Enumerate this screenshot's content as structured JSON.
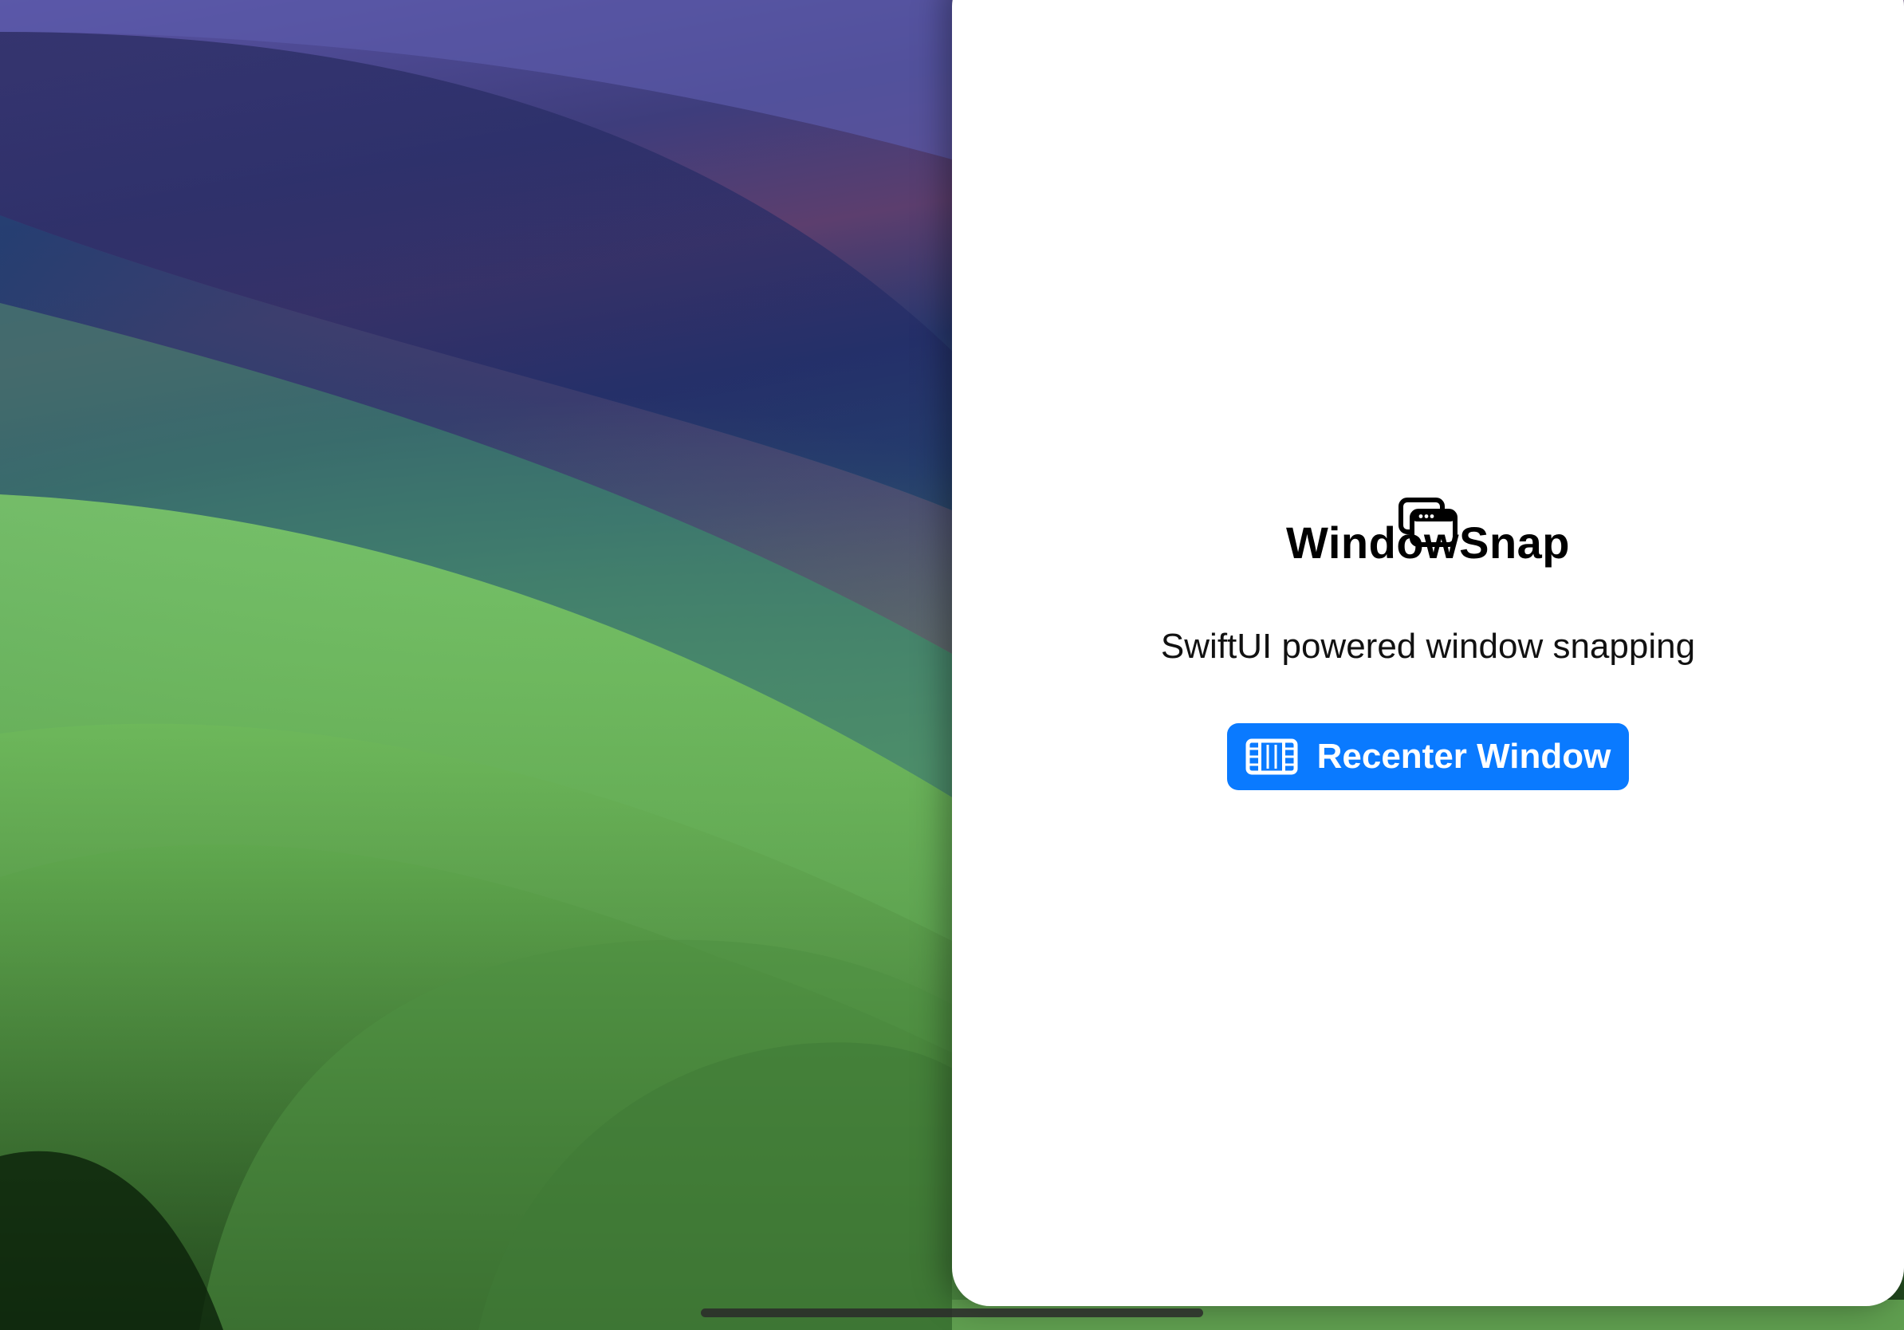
{
  "app": {
    "icon": "windows-stack-icon",
    "title": "WindowSnap",
    "subtitle": "SwiftUI powered window snapping"
  },
  "actions": {
    "recenter_button": {
      "label": "Recenter Window",
      "icon": "film-frame-icon",
      "color": "#0a7aff"
    }
  },
  "system": {
    "home_indicator": "home-indicator-bar"
  },
  "colors": {
    "window_background": "#ffffff",
    "accent": "#0a7aff",
    "text_primary": "#000000"
  }
}
